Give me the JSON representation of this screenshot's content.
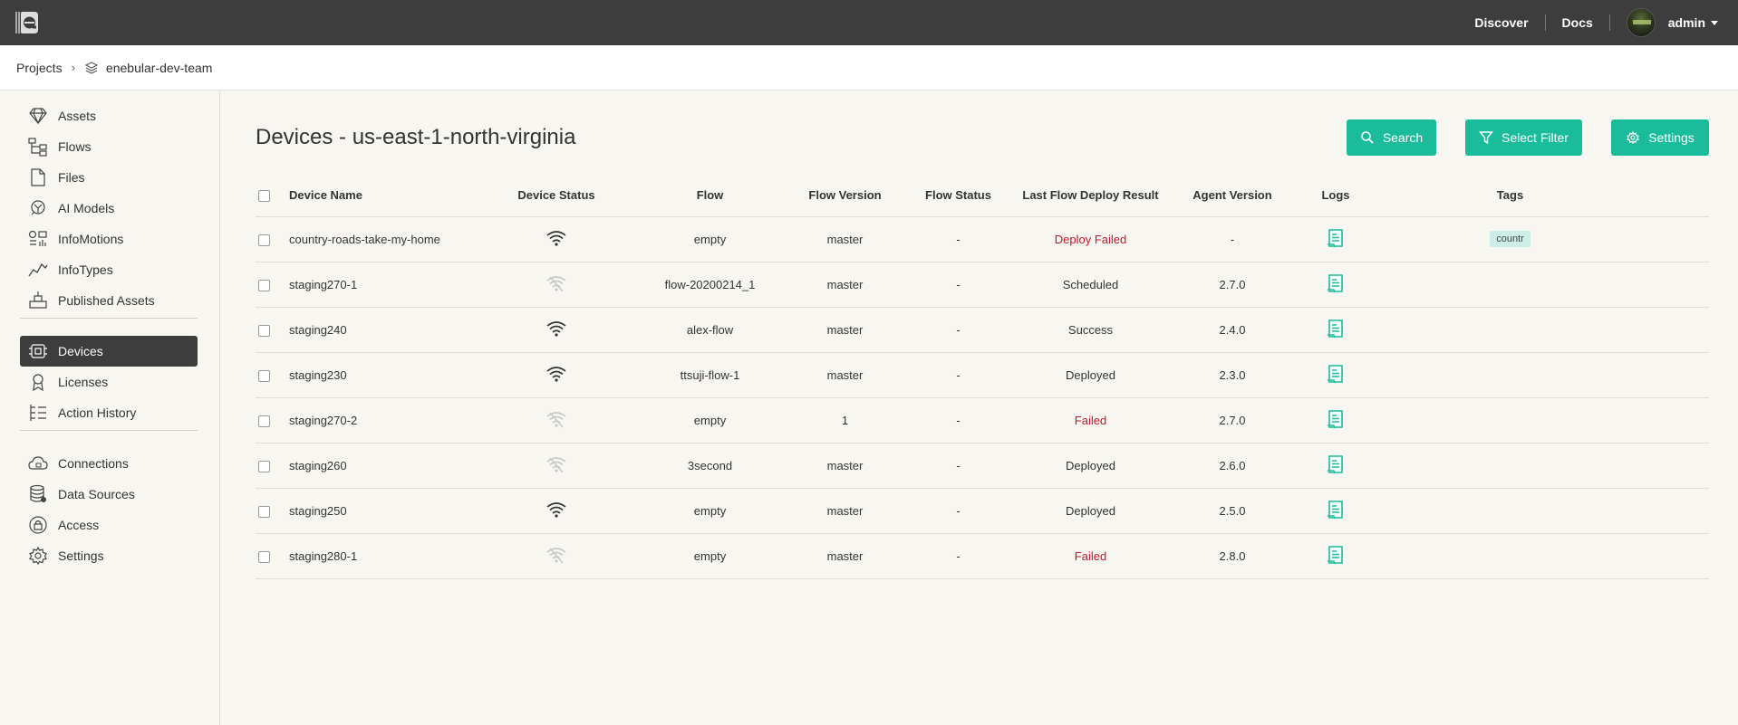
{
  "topbar": {
    "nav": [
      {
        "label": "Discover"
      },
      {
        "label": "Docs"
      }
    ],
    "user": "admin"
  },
  "breadcrumb": {
    "root": "Projects",
    "project": "enebular-dev-team"
  },
  "sidebar": {
    "items": [
      {
        "label": "Assets",
        "icon": "diamond-icon"
      },
      {
        "label": "Flows",
        "icon": "flow-icon"
      },
      {
        "label": "Files",
        "icon": "file-icon"
      },
      {
        "label": "AI Models",
        "icon": "brain-icon"
      },
      {
        "label": "InfoMotions",
        "icon": "infomotion-icon"
      },
      {
        "label": "InfoTypes",
        "icon": "line-chart-icon"
      },
      {
        "label": "Published Assets",
        "icon": "published-icon"
      }
    ],
    "items2": [
      {
        "label": "Devices",
        "icon": "device-icon",
        "active": true
      },
      {
        "label": "Licenses",
        "icon": "license-icon"
      },
      {
        "label": "Action History",
        "icon": "history-icon"
      }
    ],
    "items3": [
      {
        "label": "Connections",
        "icon": "cloud-lock-icon"
      },
      {
        "label": "Data Sources",
        "icon": "database-icon"
      },
      {
        "label": "Access",
        "icon": "lock-icon"
      },
      {
        "label": "Settings",
        "icon": "gear-icon"
      }
    ]
  },
  "main": {
    "title": "Devices - us-east-1-north-virginia",
    "buttons": {
      "search": "Search",
      "filter": "Select Filter",
      "settings": "Settings"
    },
    "columns": [
      "Device Name",
      "Device Status",
      "Flow",
      "Flow Version",
      "Flow Status",
      "Last Flow Deploy Result",
      "Agent Version",
      "Logs",
      "Tags"
    ],
    "rows": [
      {
        "name": "country-roads-take-my-home",
        "online": true,
        "flow": "empty",
        "flow_version": "master",
        "flow_status": "-",
        "deploy_result": "Deploy Failed",
        "failed": true,
        "agent": "-",
        "tag": "countr"
      },
      {
        "name": "staging270-1",
        "online": false,
        "flow": "flow-20200214_1",
        "flow_version": "master",
        "flow_status": "-",
        "deploy_result": "Scheduled",
        "failed": false,
        "agent": "2.7.0",
        "tag": ""
      },
      {
        "name": "staging240",
        "online": true,
        "flow": "alex-flow",
        "flow_version": "master",
        "flow_status": "-",
        "deploy_result": "Success",
        "failed": false,
        "agent": "2.4.0",
        "tag": ""
      },
      {
        "name": "staging230",
        "online": true,
        "flow": "ttsuji-flow-1",
        "flow_version": "master",
        "flow_status": "-",
        "deploy_result": "Deployed",
        "failed": false,
        "agent": "2.3.0",
        "tag": ""
      },
      {
        "name": "staging270-2",
        "online": false,
        "flow": "empty",
        "flow_version": "1",
        "flow_status": "-",
        "deploy_result": "Failed",
        "failed": true,
        "agent": "2.7.0",
        "tag": ""
      },
      {
        "name": "staging260",
        "online": false,
        "flow": "3second",
        "flow_version": "master",
        "flow_status": "-",
        "deploy_result": "Deployed",
        "failed": false,
        "agent": "2.6.0",
        "tag": ""
      },
      {
        "name": "staging250",
        "online": true,
        "flow": "empty",
        "flow_version": "master",
        "flow_status": "-",
        "deploy_result": "Deployed",
        "failed": false,
        "agent": "2.5.0",
        "tag": ""
      },
      {
        "name": "staging280-1",
        "online": false,
        "flow": "empty",
        "flow_version": "master",
        "flow_status": "-",
        "deploy_result": "Failed",
        "failed": true,
        "agent": "2.8.0",
        "tag": ""
      }
    ]
  },
  "colors": {
    "accent": "#1abc9c",
    "topbar": "#3d3d3d",
    "error": "#c0182a",
    "wifi_online": "#333333",
    "wifi_offline": "#c8c8c8"
  }
}
